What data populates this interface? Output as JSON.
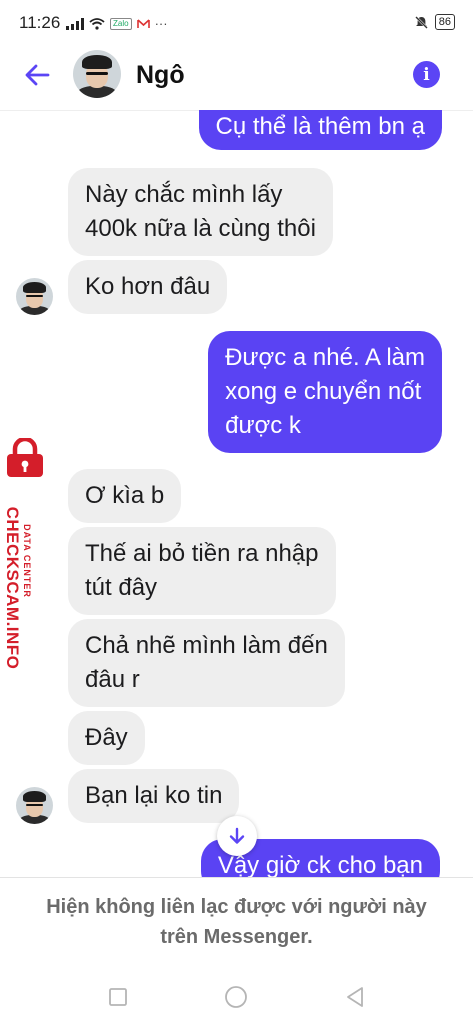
{
  "status_bar": {
    "time": "11:26",
    "more": "···",
    "battery": "86"
  },
  "header": {
    "contact_name": "Ngô"
  },
  "messages": [
    {
      "direction": "out",
      "text": "Cụ thể là thêm bn ạ"
    },
    {
      "direction": "in",
      "text": "Này chắc mình lấy\n400k nữa là cùng thôi"
    },
    {
      "direction": "in",
      "text": "Ko hơn đâu"
    },
    {
      "direction": "out",
      "text": "Được a nhé. A làm\nxong e chuyển nốt\nđược k"
    },
    {
      "direction": "in",
      "text": "Ơ kìa b"
    },
    {
      "direction": "in",
      "text": "Thế ai bỏ tiền ra nhập\ntút đây"
    },
    {
      "direction": "in",
      "text": "Chả nhẽ mình làm đến\nđâu r"
    },
    {
      "direction": "in",
      "text": "Đây"
    },
    {
      "direction": "in",
      "text": "Bạn lại ko tin"
    },
    {
      "direction": "out",
      "text": "Vậy giờ ck cho bạn"
    }
  ],
  "watermark": {
    "brand": "CHECKSCAM.INFO",
    "tagline": "DATA CENTER"
  },
  "notice": {
    "text": "Hiện không liên lạc được với người này trên Messenger."
  },
  "colors": {
    "accent": "#5b45f5",
    "incoming_bubble": "#eeeeee",
    "watermark": "#d41e2a"
  }
}
